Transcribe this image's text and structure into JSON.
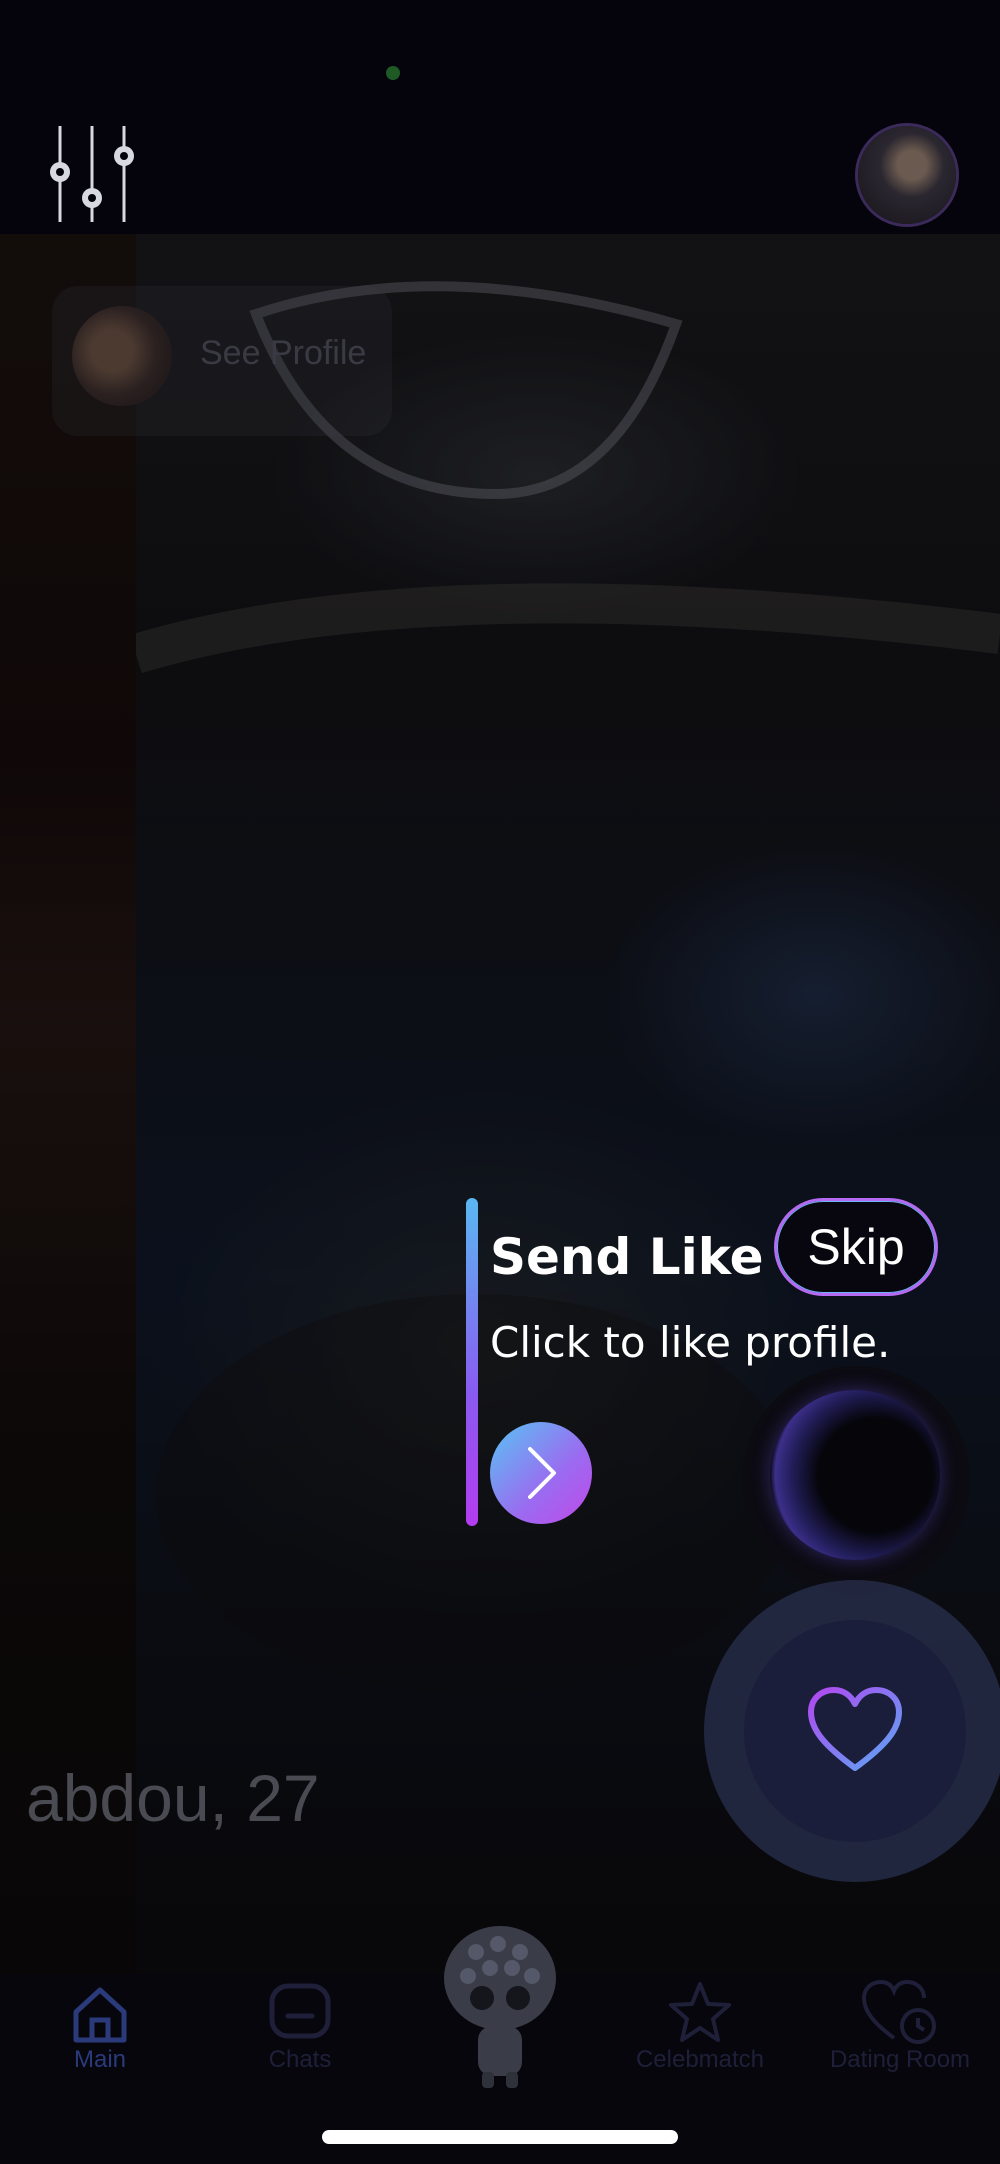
{
  "header": {
    "filter_icon": "sliders-gear-icon",
    "profile_avatar_icon": "user-avatar"
  },
  "card": {
    "see_profile_label": "See Profile",
    "online_status_color": "#2e7d32",
    "name_age": "abdou, 27"
  },
  "tooltip": {
    "title": "Send Like",
    "description": "Click to like profile.",
    "skip_label": "Skip",
    "next_icon": "chevron-right-icon",
    "accent_gradient": [
      "#5ab8f2",
      "#b43cf0"
    ]
  },
  "actions": {
    "orb_icon": "orb-icon",
    "like_icon": "heart-icon"
  },
  "bottom_nav": {
    "items": [
      {
        "label": "Main",
        "icon": "home-icon",
        "active": true
      },
      {
        "label": "Chats",
        "icon": "chat-icon",
        "active": false
      },
      {
        "label": "",
        "icon": "mascot-icon",
        "active": false
      },
      {
        "label": "Celebmatch",
        "icon": "star-icon",
        "active": false
      },
      {
        "label": "Dating Room",
        "icon": "heart-clock-icon",
        "active": false
      }
    ]
  }
}
